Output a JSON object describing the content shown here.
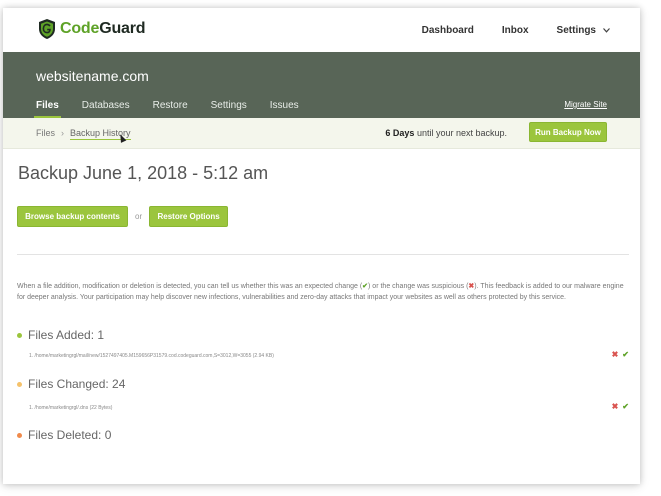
{
  "brand": {
    "name_part1": "Code",
    "name_part2": "Guard",
    "green": "#5ea227",
    "accent": "#9bc53d",
    "header_bg": "#586557"
  },
  "topnav": {
    "dashboard": "Dashboard",
    "inbox": "Inbox",
    "settings": "Settings"
  },
  "site": {
    "name": "websitename.com"
  },
  "tabs": [
    {
      "label": "Files",
      "active": true
    },
    {
      "label": "Databases",
      "active": false
    },
    {
      "label": "Restore",
      "active": false
    },
    {
      "label": "Settings",
      "active": false
    },
    {
      "label": "Issues",
      "active": false
    }
  ],
  "migrate_link": "Migrate Site",
  "breadcrumb": {
    "root": "Files",
    "separator": "›",
    "current": "Backup History"
  },
  "next_backup": {
    "days": "6 Days",
    "suffix": " until your next backup."
  },
  "run_backup_label": "Run Backup Now",
  "page_title": "Backup June 1, 2018 - 5:12 am",
  "actions": {
    "browse_label": "Browse backup contents",
    "or_label": "or",
    "restore_label": "Restore Options"
  },
  "info": {
    "part1": "When a file addition, modification or deletion is detected, you can tell us whether this was an expected change (",
    "part2": ") or the change was suspicious (",
    "part3": "). This feedback is added to our malware engine for deeper analysis. Your participation may help discover new infections, vulnerabilities and zero-day attacks that impact your websites as well as others protected by this service."
  },
  "sections": {
    "added": {
      "title": "Files Added: 1",
      "color": "#9bc53d",
      "file": "1. /home/marketingrgl/mail/new/1527497405.M159656P31579.cod.codeguard.com,S=3012,W=3055 (2.94 KB)"
    },
    "changed": {
      "title": "Files Changed: 24",
      "color": "#f5c26b",
      "file": "1. /home/marketingrgl/.dns (22 Bytes)"
    },
    "deleted": {
      "title": "Files Deleted: 0",
      "color": "#f08a4b"
    }
  },
  "icons": {
    "reject": "✖",
    "approve": "✔"
  }
}
